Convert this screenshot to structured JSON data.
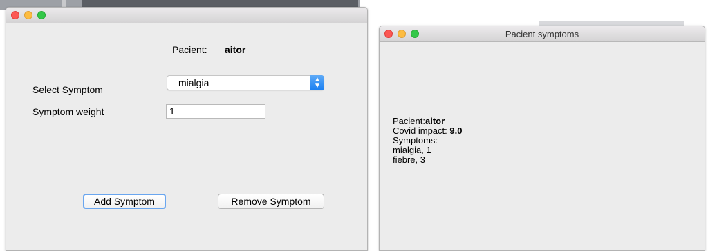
{
  "form_window": {
    "title": "",
    "patient_label": "Pacient:",
    "patient_name": "aitor",
    "select_symptom_label": "Select Symptom",
    "symptom_selected": "mialgia",
    "symptom_weight_label": "Symptom weight",
    "symptom_weight_value": "1",
    "add_button": "Add Symptom",
    "remove_button": "Remove Symptom"
  },
  "result_window": {
    "title": "Pacient symptoms",
    "patient_label": "Pacient:",
    "patient_name": "aitor",
    "covid_impact_label": "Covid impact: ",
    "covid_impact_value": "9.0",
    "symptoms_label": "Symptoms:",
    "symptoms": [
      "mialgia, 1",
      "fiebre, 3"
    ]
  },
  "colors": {
    "close": "#fc5753",
    "minimize": "#fdbc40",
    "maximize": "#33c748",
    "focus_ring": "#6aa6ef"
  }
}
